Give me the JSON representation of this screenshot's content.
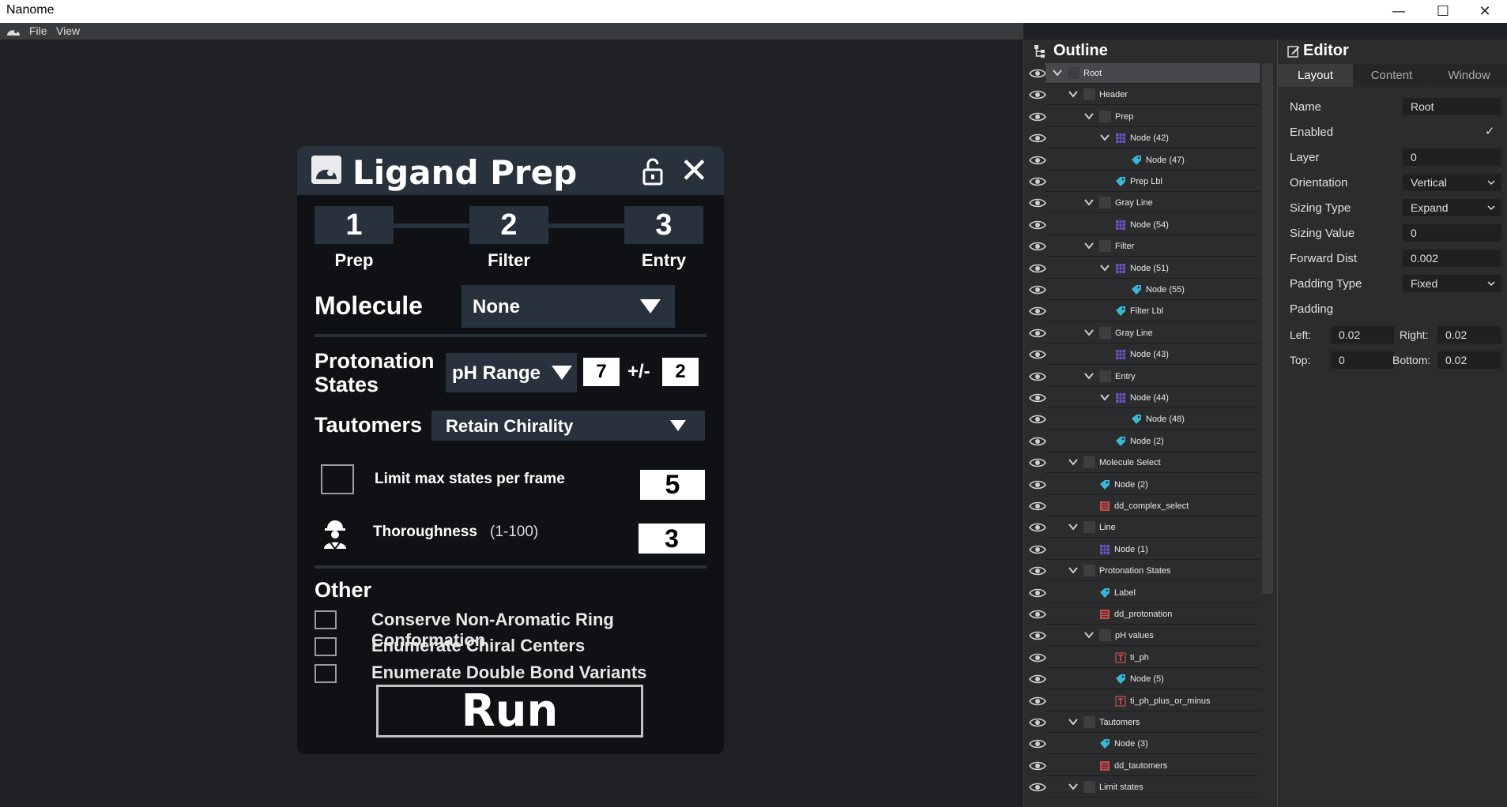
{
  "window": {
    "title": "Nanome",
    "minimize": "—",
    "maximize": "☐",
    "close": "✕"
  },
  "menu": {
    "items": [
      "File",
      "View"
    ]
  },
  "ligand_panel": {
    "title": "Ligand Prep",
    "steps": [
      {
        "num": "1",
        "label": "Prep"
      },
      {
        "num": "2",
        "label": "Filter"
      },
      {
        "num": "3",
        "label": "Entry"
      }
    ],
    "molecule_label": "Molecule",
    "molecule_value": "None",
    "protonation_label_1": "Protonation",
    "protonation_label_2": "States",
    "protonation_value": "pH Range",
    "ph_value": "7",
    "plus_minus": "+/-",
    "ph_range": "2",
    "tautomers_label": "Tautomers",
    "tautomers_value": "Retain Chirality",
    "limit_label": "Limit max states per frame",
    "limit_value": "5",
    "thoroughness_label": "Thoroughness",
    "thoroughness_range": "(1-100)",
    "thoroughness_value": "3",
    "other_label": "Other",
    "options": [
      "Conserve Non-Aromatic Ring Conformation",
      "Enumerate Chiral Centers",
      "Enumerate Double Bond Variants"
    ],
    "run_label": "Run"
  },
  "outline": {
    "title": "Outline",
    "rows": [
      {
        "label": "Root",
        "depth": 0,
        "type": "box",
        "expanded": true,
        "selected": true
      },
      {
        "label": "Header",
        "depth": 1,
        "type": "box",
        "expanded": true
      },
      {
        "label": "Prep",
        "depth": 2,
        "type": "box",
        "expanded": true
      },
      {
        "label": "Node (42)",
        "depth": 3,
        "type": "mesh",
        "expanded": true
      },
      {
        "label": "Node (47)",
        "depth": 4,
        "type": "label"
      },
      {
        "label": "Prep Lbl",
        "depth": 3,
        "type": "label"
      },
      {
        "label": "Gray Line",
        "depth": 2,
        "type": "box",
        "expanded": true
      },
      {
        "label": "Node (54)",
        "depth": 3,
        "type": "mesh"
      },
      {
        "label": "Filter",
        "depth": 2,
        "type": "box",
        "expanded": true
      },
      {
        "label": "Node (51)",
        "depth": 3,
        "type": "mesh",
        "expanded": true
      },
      {
        "label": "Node (55)",
        "depth": 4,
        "type": "label"
      },
      {
        "label": "Filter Lbl",
        "depth": 3,
        "type": "label"
      },
      {
        "label": "Gray Line",
        "depth": 2,
        "type": "box",
        "expanded": true
      },
      {
        "label": "Node (43)",
        "depth": 3,
        "type": "mesh"
      },
      {
        "label": "Entry",
        "depth": 2,
        "type": "box",
        "expanded": true
      },
      {
        "label": "Node (44)",
        "depth": 3,
        "type": "mesh",
        "expanded": true
      },
      {
        "label": "Node (48)",
        "depth": 4,
        "type": "label"
      },
      {
        "label": "Node (2)",
        "depth": 3,
        "type": "label"
      },
      {
        "label": "Molecule Select",
        "depth": 1,
        "type": "box",
        "expanded": true
      },
      {
        "label": "Node (2)",
        "depth": 2,
        "type": "label"
      },
      {
        "label": "dd_complex_select",
        "depth": 2,
        "type": "dropdown"
      },
      {
        "label": "Line",
        "depth": 1,
        "type": "box",
        "expanded": true
      },
      {
        "label": "Node (1)",
        "depth": 2,
        "type": "mesh"
      },
      {
        "label": "Protonation States",
        "depth": 1,
        "type": "box",
        "expanded": true
      },
      {
        "label": "Label",
        "depth": 2,
        "type": "label"
      },
      {
        "label": "dd_protonation",
        "depth": 2,
        "type": "dropdown"
      },
      {
        "label": "pH values",
        "depth": 2,
        "type": "box",
        "expanded": true
      },
      {
        "label": "ti_ph",
        "depth": 3,
        "type": "text"
      },
      {
        "label": "Node (5)",
        "depth": 3,
        "type": "label"
      },
      {
        "label": "ti_ph_plus_or_minus",
        "depth": 3,
        "type": "text"
      },
      {
        "label": "Tautomers",
        "depth": 1,
        "type": "box",
        "expanded": true
      },
      {
        "label": "Node (3)",
        "depth": 2,
        "type": "label"
      },
      {
        "label": "dd_tautomers",
        "depth": 2,
        "type": "dropdown"
      },
      {
        "label": "Limit states",
        "depth": 1,
        "type": "box",
        "expanded": true
      }
    ]
  },
  "editor": {
    "title": "Editor",
    "tabs": [
      "Layout",
      "Content",
      "Window"
    ],
    "name_label": "Name",
    "name_value": "Root",
    "enabled_label": "Enabled",
    "enabled_check": "✓",
    "layer_label": "Layer",
    "layer_value": "0",
    "orientation_label": "Orientation",
    "orientation_value": "Vertical",
    "sizing_type_label": "Sizing Type",
    "sizing_type_value": "Expand",
    "sizing_value_label": "Sizing Value",
    "sizing_value_value": "0",
    "forward_dist_label": "Forward Dist",
    "forward_dist_value": "0.002",
    "padding_type_label": "Padding Type",
    "padding_type_value": "Fixed",
    "padding_label": "Padding",
    "left_label": "Left:",
    "left_value": "0.02",
    "right_label": "Right:",
    "right_value": "0.02",
    "top_label": "Top:",
    "top_value": "0",
    "bottom_label": "Bottom:",
    "bottom_value": "0.02"
  }
}
